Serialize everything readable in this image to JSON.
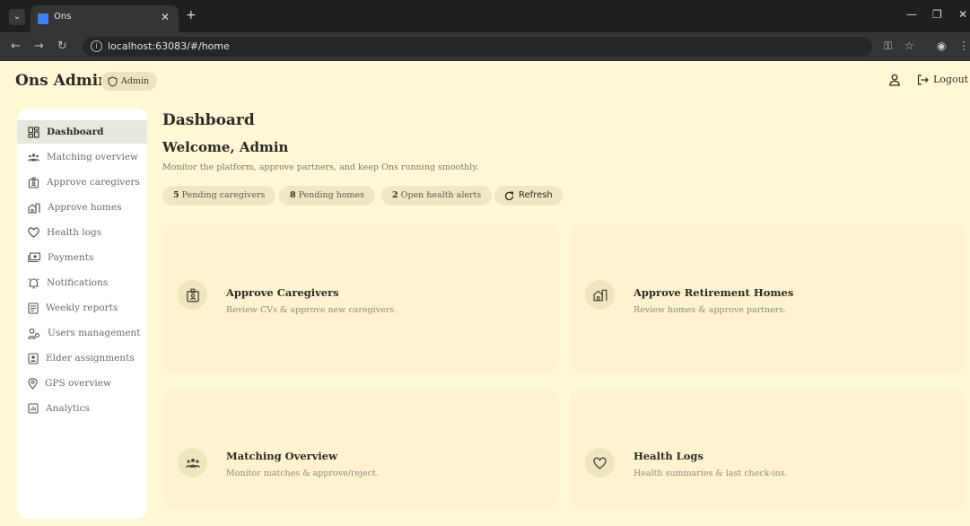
{
  "browser": {
    "tab_title": "Ons",
    "url": "localhost:63083/#/home"
  },
  "header": {
    "app_title": "Ons Admin",
    "role_badge": "Admin",
    "logout_label": "Logout"
  },
  "sidebar": {
    "items": [
      {
        "label": "Dashboard",
        "icon": "dashboard-icon",
        "active": true
      },
      {
        "label": "Matching overview",
        "icon": "people-icon"
      },
      {
        "label": "Approve caregivers",
        "icon": "badge-icon"
      },
      {
        "label": "Approve homes",
        "icon": "home-icon"
      },
      {
        "label": "Health logs",
        "icon": "heart-icon"
      },
      {
        "label": "Payments",
        "icon": "payments-icon"
      },
      {
        "label": "Notifications",
        "icon": "bell-icon"
      },
      {
        "label": "Weekly reports",
        "icon": "report-icon"
      },
      {
        "label": "Users management",
        "icon": "users-icon"
      },
      {
        "label": "Elder assignments",
        "icon": "assignment-icon"
      },
      {
        "label": "GPS overview",
        "icon": "location-pin-icon"
      },
      {
        "label": "Analytics",
        "icon": "analytics-icon"
      }
    ]
  },
  "main": {
    "title": "Dashboard",
    "welcome": "Welcome, Admin",
    "subtitle": "Monitor the platform, approve partners, and keep Ons running smoothly.",
    "stats": [
      {
        "count": "5",
        "label": "Pending caregivers"
      },
      {
        "count": "8",
        "label": "Pending homes"
      },
      {
        "count": "2",
        "label": "Open health alerts"
      }
    ],
    "refresh_label": "Refresh",
    "cards": [
      {
        "title": "Approve Caregivers",
        "desc": "Review CVs & approve new caregivers.",
        "icon": "badge-icon"
      },
      {
        "title": "Approve Retirement Homes",
        "desc": "Review homes & approve partners.",
        "icon": "home-icon"
      },
      {
        "title": "Matching Overview",
        "desc": "Monitor matches & approve/reject.",
        "icon": "people-icon"
      },
      {
        "title": "Health Logs",
        "desc": "Health summaries & last check-ins.",
        "icon": "heart-icon"
      }
    ]
  },
  "colors": {
    "background": "#fff7d6",
    "card": "#fff3cf",
    "chip": "#efe7c1",
    "sidebar_active": "#e6e7dd"
  }
}
